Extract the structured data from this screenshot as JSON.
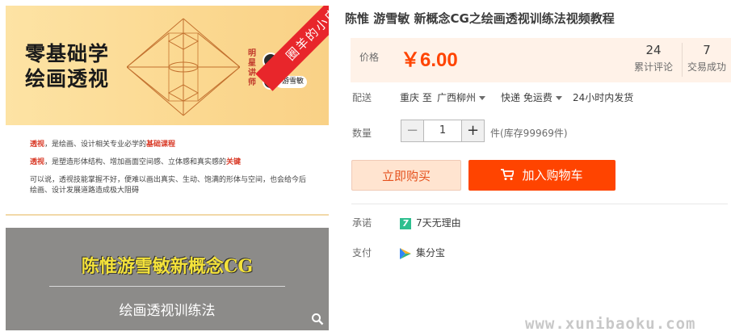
{
  "gallery": {
    "banner": {
      "title_line1": "零基础学",
      "title_line2": "绘画透视",
      "tag": "明星讲师",
      "ribbon": "圈羊的小店",
      "teachers": [
        "陈惟",
        "游雪敏"
      ]
    },
    "description": {
      "p1_key": "透视",
      "p1_text": "，是绘画、设计相关专业必学的",
      "p1_em": "基础课程",
      "p2_key": "透视",
      "p2_text": "，是塑造形体结构、增加画面空间感、立体感和真实感的",
      "p2_em": "关键",
      "p3_text": "可以说，透视技能掌握不好，便难以画出真实、生动、饱满的形体与空间，也会给今后绘画、设计发展道路造成极大阻碍"
    },
    "second": {
      "title": "陈惟游雪敏新概念CG",
      "subtitle": "绘画透视训练法"
    },
    "zoom_icon": "search-icon"
  },
  "product": {
    "title": "陈惟 游雪敏 新概念CG之绘画透视训练法视频教程",
    "price_label": "价格",
    "price": "￥6.00",
    "reviews_count": "24",
    "reviews_label": "累计评论",
    "sales_count": "7",
    "sales_label": "交易成功",
    "shipping_label": "配送",
    "ship_from": "重庆 至",
    "ship_to": "广西柳州",
    "ship_method": "快递 免运费",
    "ship_time": "24小时内发货",
    "qty_label": "数量",
    "qty_minus": "−",
    "qty_value": "1",
    "qty_plus": "+",
    "stock": "件(库存99969件)",
    "buy_now": "立即购买",
    "add_cart": "加入购物车",
    "promise_label": "承诺",
    "promise_badge": "7",
    "promise_text": "7天无理由",
    "pay_label": "支付",
    "pay_text": "集分宝"
  },
  "watermark": "www.xunibaoku.com",
  "colors": {
    "accent": "#ff4400",
    "price_bg": "#fff2e8",
    "ribbon": "#e8262b",
    "badge": "#2ebf8f"
  }
}
